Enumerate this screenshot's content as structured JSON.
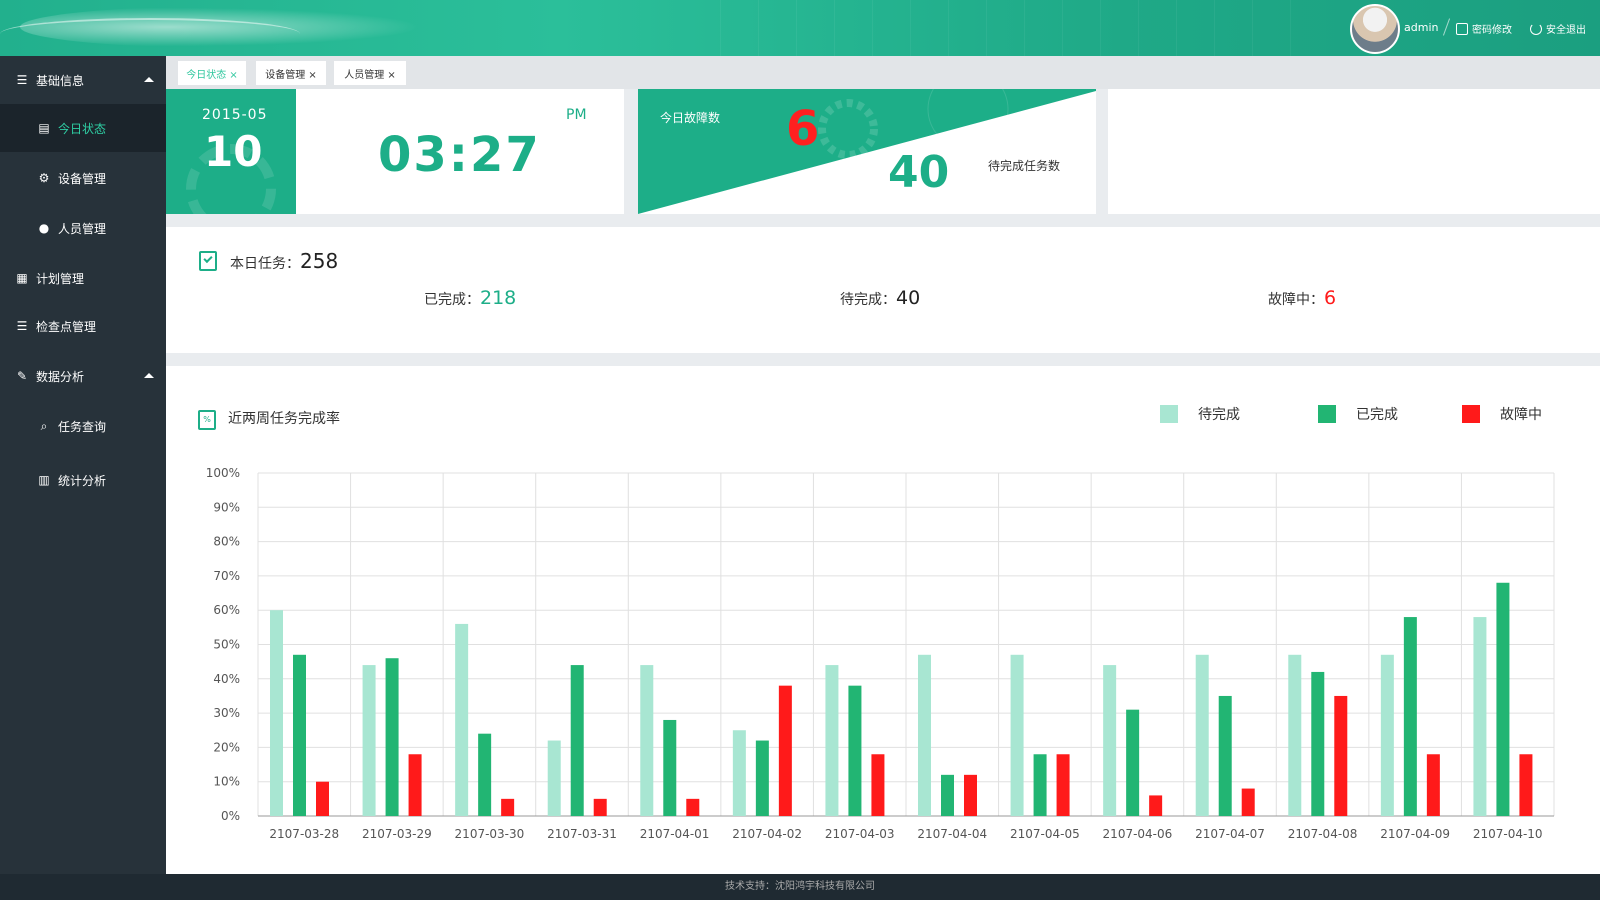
{
  "header": {
    "user": "admin",
    "change_password": "密码修改",
    "logout": "安全退出"
  },
  "sidebar": {
    "items": [
      {
        "label": "基础信息",
        "icon": "list-icon"
      },
      {
        "label": "今日状态",
        "icon": "document-icon"
      },
      {
        "label": "设备管理",
        "icon": "gear-icon"
      },
      {
        "label": "人员管理",
        "icon": "user-icon"
      },
      {
        "label": "计划管理",
        "icon": "plan-icon"
      },
      {
        "label": "检查点管理",
        "icon": "list-icon"
      },
      {
        "label": "数据分析",
        "icon": "edit-icon"
      },
      {
        "label": "任务查询",
        "icon": "search-document-icon"
      },
      {
        "label": "统计分析",
        "icon": "bar-chart-icon"
      }
    ]
  },
  "tabs": [
    {
      "label": "今日状态 ×"
    },
    {
      "label": "设备管理 ×"
    },
    {
      "label": "人员管理 ×"
    }
  ],
  "date": {
    "year_month": "2015-05",
    "day": "10"
  },
  "clock": {
    "ampm": "PM",
    "time": "03:27"
  },
  "fault_panel": {
    "fault_label": "今日故障数",
    "fault_count": "6",
    "pending_count": "40",
    "pending_label": "待完成任务数"
  },
  "tasks": {
    "title": "本日任务：",
    "total": "258",
    "done_label": "已完成：",
    "done": "218",
    "pending_label": "待完成：",
    "pending": "40",
    "fault_label": "故障中：",
    "fault": "6"
  },
  "colors": {
    "accent": "#1dae88",
    "pending": "#a8e6d2",
    "done": "#22b573",
    "fault": "#ff1a1a"
  },
  "footer": {
    "text": "技术支持：沈阳鸿宇科技有限公司"
  },
  "chart_data": {
    "type": "bar",
    "title": "近两周任务完成率",
    "categories": [
      "2107-03-28",
      "2107-03-29",
      "2107-03-30",
      "2107-03-31",
      "2107-04-01",
      "2107-04-02",
      "2107-04-03",
      "2107-04-04",
      "2107-04-05",
      "2107-04-06",
      "2107-04-07",
      "2107-04-08",
      "2107-04-09",
      "2107-04-10"
    ],
    "series": [
      {
        "name": "待完成",
        "color": "#a8e6d2",
        "values": [
          60,
          44,
          56,
          22,
          44,
          25,
          44,
          47,
          47,
          44,
          47,
          47,
          47,
          58
        ]
      },
      {
        "name": "已完成",
        "color": "#22b573",
        "values": [
          47,
          46,
          24,
          44,
          28,
          22,
          38,
          12,
          18,
          31,
          35,
          42,
          58,
          68
        ]
      },
      {
        "name": "故障中",
        "color": "#ff1a1a",
        "values": [
          10,
          18,
          5,
          5,
          5,
          38,
          18,
          12,
          18,
          6,
          8,
          35,
          18,
          18
        ]
      }
    ],
    "yticks": [
      "100%",
      "90%",
      "80%",
      "70%",
      "60%",
      "50%",
      "40%",
      "30%",
      "20%",
      "10%",
      "0%"
    ],
    "ylim": [
      0,
      100
    ],
    "grid": true,
    "legend": "top-right"
  }
}
